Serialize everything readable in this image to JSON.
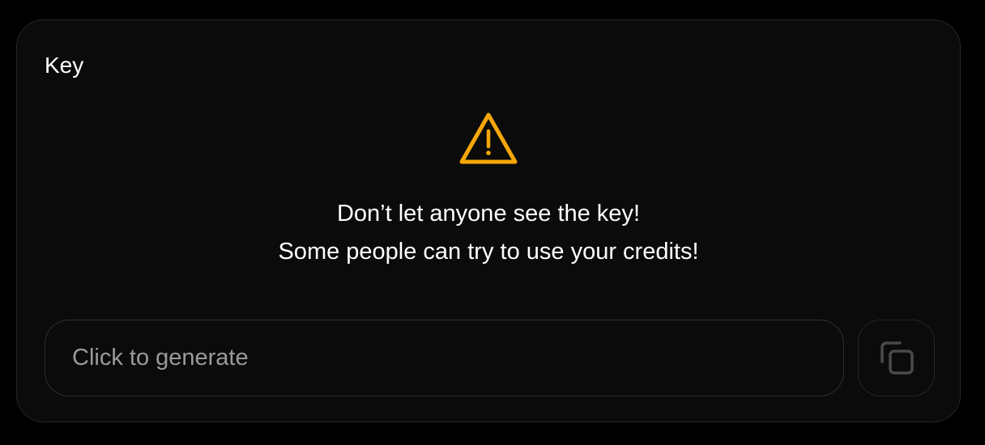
{
  "card": {
    "title": "Key"
  },
  "warning": {
    "icon": "warning-triangle-icon",
    "icon_color": "#F5A60A",
    "line1": "Don’t let anyone see the key!",
    "line2": "Some people can try to use your credits!"
  },
  "key_field": {
    "placeholder": "Click to generate",
    "value": ""
  },
  "copy_button": {
    "icon": "copy-icon"
  }
}
